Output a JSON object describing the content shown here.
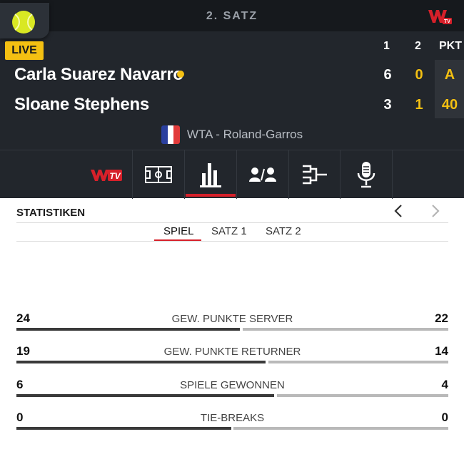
{
  "header": {
    "set_title": "2. SATZ",
    "live_label": "LIVE",
    "columns": [
      "1",
      "2",
      "PKT"
    ]
  },
  "players": [
    {
      "name": "Carla Suarez Navarro",
      "serving": true,
      "set1": "6",
      "set2": "0",
      "points": "A"
    },
    {
      "name": "Sloane Stephens",
      "serving": false,
      "set1": "3",
      "set2": "1",
      "points": "40"
    }
  ],
  "tournament": {
    "name": "WTA - Roland-Garros",
    "flag": "france-flag"
  },
  "tabs": [
    {
      "name": "tv",
      "icon": "winamax-tv-icon"
    },
    {
      "name": "court",
      "icon": "court-icon"
    },
    {
      "name": "stats",
      "icon": "bar-chart-icon",
      "active": true
    },
    {
      "name": "head-to-head",
      "icon": "h2h-icon"
    },
    {
      "name": "draw",
      "icon": "bracket-icon"
    },
    {
      "name": "commentary",
      "icon": "microphone-icon"
    }
  ],
  "stats": {
    "title": "STATISTIKEN",
    "subtabs": [
      "SPIEL",
      "SATZ 1",
      "SATZ 2"
    ],
    "active_subtab": "SPIEL",
    "rows": [
      {
        "label": "GEW. PUNKTE SERVER",
        "left": "24",
        "right": "22",
        "left_ratio": 0.52
      },
      {
        "label": "GEW. PUNKTE RETURNER",
        "left": "19",
        "right": "14",
        "left_ratio": 0.58
      },
      {
        "label": "SPIELE GEWONNEN",
        "left": "6",
        "right": "4",
        "left_ratio": 0.6
      },
      {
        "label": "TIE-BREAKS",
        "left": "0",
        "right": "0",
        "left_ratio": 0.5
      }
    ]
  },
  "colors": {
    "accent": "#f4c012",
    "active_red": "#d6202a",
    "panel": "#22262c"
  }
}
